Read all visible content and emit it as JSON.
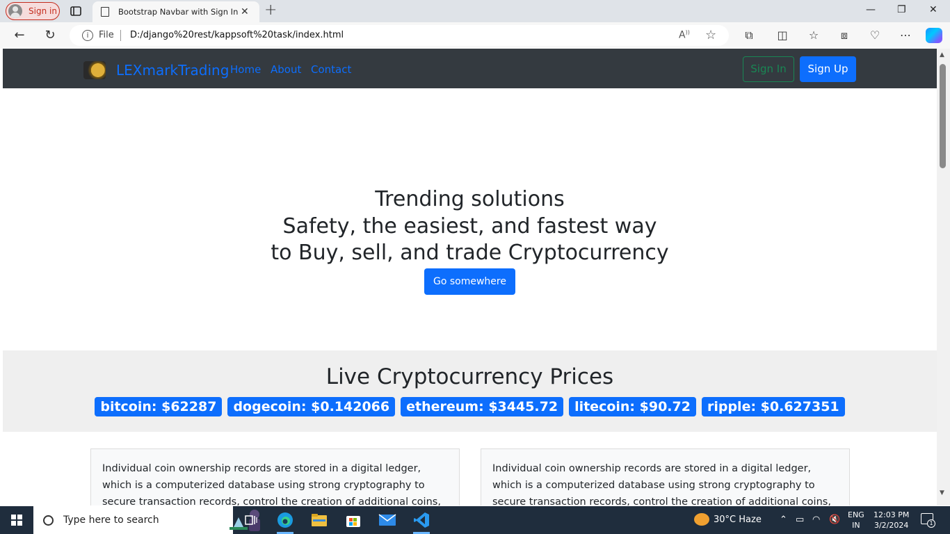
{
  "browser": {
    "profile_label": "Sign in",
    "tab_title": "Bootstrap Navbar with Sign In/Si",
    "address_scheme": "File",
    "url": "D:/django%20rest/kappsoft%20task/index.html"
  },
  "site": {
    "brand": "LEXmarkTrading",
    "nav_links": [
      "Home",
      "About",
      "Contact"
    ],
    "sign_in": "Sign In",
    "sign_up": "Sign Up"
  },
  "hero": {
    "line1": "Trending solutions",
    "line2": "Safety, the easiest, and fastest way",
    "line3": "to Buy, sell, and trade Cryptocurrency",
    "button": "Go somewhere"
  },
  "prices": {
    "heading": "Live Cryptocurrency Prices",
    "items": [
      "bitcoin: $62287",
      "dogecoin: $0.142066",
      "ethereum: $3445.72",
      "litecoin: $90.72",
      "ripple: $0.627351"
    ]
  },
  "cards": [
    {
      "text": "Individual coin ownership records are stored in a digital ledger, which is a computerized database using strong cryptography to secure transaction records, control the creation of additional coins, and verify"
    },
    {
      "text": "Individual coin ownership records are stored in a digital ledger, which is a computerized database using strong cryptography to secure transaction records, control the creation of additional coins, and verify"
    }
  ],
  "taskbar": {
    "search_placeholder": "Type here to search",
    "weather": "30°C  Haze",
    "lang_line1": "ENG",
    "lang_line2": "IN",
    "time": "12:03 PM",
    "date": "3/2/2024",
    "notification_count": "1"
  },
  "colors": {
    "primary": "#0d6efd",
    "success": "#198754",
    "navbar": "#343a40"
  }
}
